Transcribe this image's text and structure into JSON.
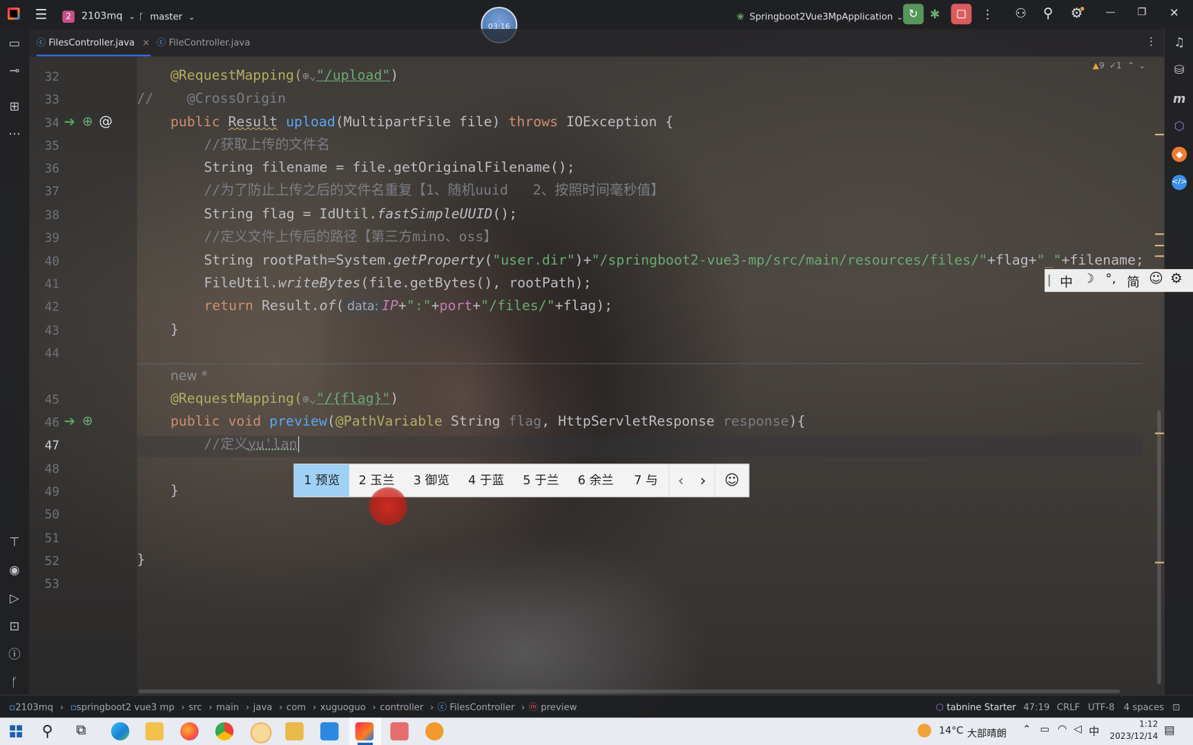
{
  "topbar": {
    "project_badge": "2",
    "project": "2103mq",
    "branch": "master",
    "timer": "03:16",
    "run_config": "Springboot2Vue3MpApplication"
  },
  "tabs": [
    {
      "label": "FilesController.java",
      "active": true
    },
    {
      "label": "FileController.java",
      "active": false
    }
  ],
  "inspections": {
    "warnings": "9",
    "weak": "1"
  },
  "editor": {
    "lines": [
      {
        "n": "32",
        "text": "@RequestMapping(",
        "path": "\"/upload\"",
        "close": ")"
      },
      {
        "n": "33"
      },
      {
        "n": "34"
      },
      {
        "n": "35"
      },
      {
        "n": "36"
      },
      {
        "n": "37"
      },
      {
        "n": "38"
      },
      {
        "n": "39"
      },
      {
        "n": "40"
      },
      {
        "n": "41"
      },
      {
        "n": "42"
      },
      {
        "n": "43"
      },
      {
        "n": "44"
      },
      {
        "n": "45"
      },
      {
        "n": "46"
      },
      {
        "n": "47"
      },
      {
        "n": "48"
      },
      {
        "n": "49"
      },
      {
        "n": "50"
      },
      {
        "n": "51"
      },
      {
        "n": "52"
      },
      {
        "n": "53"
      }
    ],
    "code": {
      "l32_a": "@RequestMapping(",
      "l32_b": "\"/upload\"",
      "l32_c": ")",
      "l33_a": "//",
      "l33_b": "@CrossOrigin",
      "l34_a": "public ",
      "l34_b": "Result",
      "l34_c": " ",
      "l34_d": "upload",
      "l34_e": "(MultipartFile file) ",
      "l34_f": "throws",
      "l34_g": " IOException {",
      "l35": "//获取上传的文件名",
      "l36": "String filename = file.getOriginalFilename();",
      "l37": "//为了防止上传之后的文件名重复【1、随机uuid   2、按照时间毫秒值】",
      "l38_a": "String flag = IdUtil.",
      "l38_b": "fastSimpleUUID",
      "l38_c": "();",
      "l39": "//定义文件上传后的路径【第三方mino、oss】",
      "l40_a": "String rootPath=System.",
      "l40_b": "getProperty",
      "l40_c": "(",
      "l40_d": "\"user.dir\"",
      "l40_e": ")+",
      "l40_f": "\"/springboot2-vue3-mp/src/main/resources/files/\"",
      "l40_g": "+flag+",
      "l40_h": "\"_\"",
      "l40_i": "+filename;",
      "l41_a": "FileUtil.",
      "l41_b": "writeBytes",
      "l41_c": "(file.getBytes(), rootPath);",
      "l42_a": "return",
      "l42_b": " Result.",
      "l42_c": "of",
      "l42_d": "(",
      "l42_hint": "data:",
      "l42_e": "IP",
      "l42_f": "+",
      "l42_g": "\":\"",
      "l42_h": "+",
      "l42_i": "port",
      "l42_j": "+",
      "l42_k": "\"/files/\"",
      "l42_l": "+flag);",
      "l43": "}",
      "new_marker": "new *",
      "l45_a": "@RequestMapping(",
      "l45_b": "\"/{flag}\"",
      "l45_c": ")",
      "l46_a": "public void ",
      "l46_b": "preview",
      "l46_c": "(",
      "l46_d": "@PathVariable",
      "l46_e": " String ",
      "l46_f": "flag",
      "l46_g": ", HttpServletResponse ",
      "l46_h": "response",
      "l46_i": "){",
      "l47_a": "//定义",
      "l47_b": "yu'lan",
      "l49": "}",
      "l52": "}"
    }
  },
  "ime": {
    "candidates": [
      {
        "num": "1",
        "text": "预览"
      },
      {
        "num": "2",
        "text": "玉兰"
      },
      {
        "num": "3",
        "text": "御览"
      },
      {
        "num": "4",
        "text": "于蓝"
      },
      {
        "num": "5",
        "text": "于兰"
      },
      {
        "num": "6",
        "text": "余兰"
      },
      {
        "num": "7",
        "text": "与"
      }
    ],
    "prev": "‹",
    "next": "›",
    "emoji": "☺",
    "toolbar": [
      "中",
      "☽",
      "°,",
      "简",
      "☺",
      "⚙"
    ]
  },
  "statusbar": {
    "breadcrumb": [
      "2103mq",
      "springboot2 vue3 mp",
      "src",
      "main",
      "java",
      "com",
      "xuguoguo",
      "controller",
      "FilesController",
      "preview"
    ],
    "tabnine": "tabnine Starter",
    "position": "47:19",
    "line_sep": "CRLF",
    "encoding": "UTF-8",
    "indent": "4 spaces"
  },
  "taskbar": {
    "weather_temp": "14°C",
    "weather_desc": "大部晴朗",
    "lang": "中",
    "time": "1:12",
    "date": "2023/12/14"
  },
  "colors": {
    "keyword": "#cf8e6d",
    "function": "#56a8f5",
    "string": "#6aab73",
    "annotation": "#b3ae60",
    "comment": "#7a7e85",
    "ime_selected": "#9fd0f6"
  }
}
